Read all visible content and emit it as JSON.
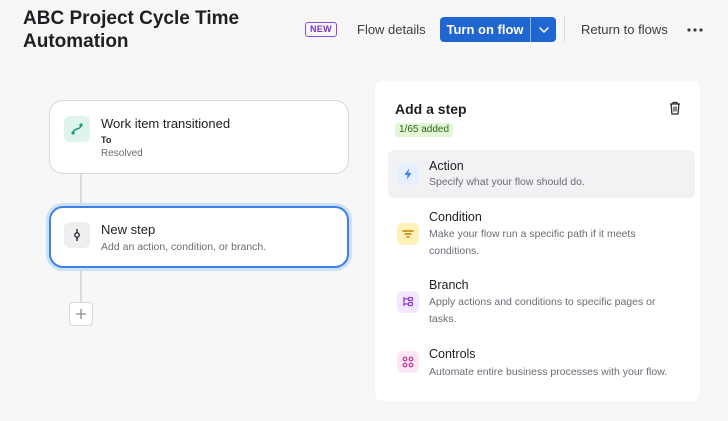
{
  "header": {
    "title": "ABC Project Cycle Time Automation",
    "new_badge": "NEW",
    "flow_details": "Flow details",
    "turn_on_flow": "Turn on flow",
    "return_to_flows": "Return to flows"
  },
  "canvas": {
    "trigger": {
      "title": "Work item transitioned",
      "sub_label": "To",
      "sub_value": "Resolved",
      "icon": "transition-icon"
    },
    "new_step": {
      "title": "New step",
      "subtitle": "Add an action, condition, or branch.",
      "icon": "new-step-icon"
    }
  },
  "panel": {
    "title": "Add a step",
    "count": "1/65 added",
    "items": [
      {
        "title": "Action",
        "description": "Specify what your flow should do.",
        "icon": "lightning-icon",
        "color": "#3b82e8",
        "bg": "#e6efff"
      },
      {
        "title": "Condition",
        "description": "Make your flow run a specific path if it meets conditions.",
        "icon": "filter-icon",
        "color": "#b8860b",
        "bg": "#fff1b8"
      },
      {
        "title": "Branch",
        "description": "Apply actions and conditions to specific pages or tasks.",
        "icon": "branch-icon",
        "color": "#8b3fd1",
        "bg": "#f3e6ff"
      },
      {
        "title": "Controls",
        "description": "Automate entire business processes with your flow.",
        "icon": "controls-icon",
        "color": "#c1369a",
        "bg": "#fde6f5"
      }
    ]
  }
}
